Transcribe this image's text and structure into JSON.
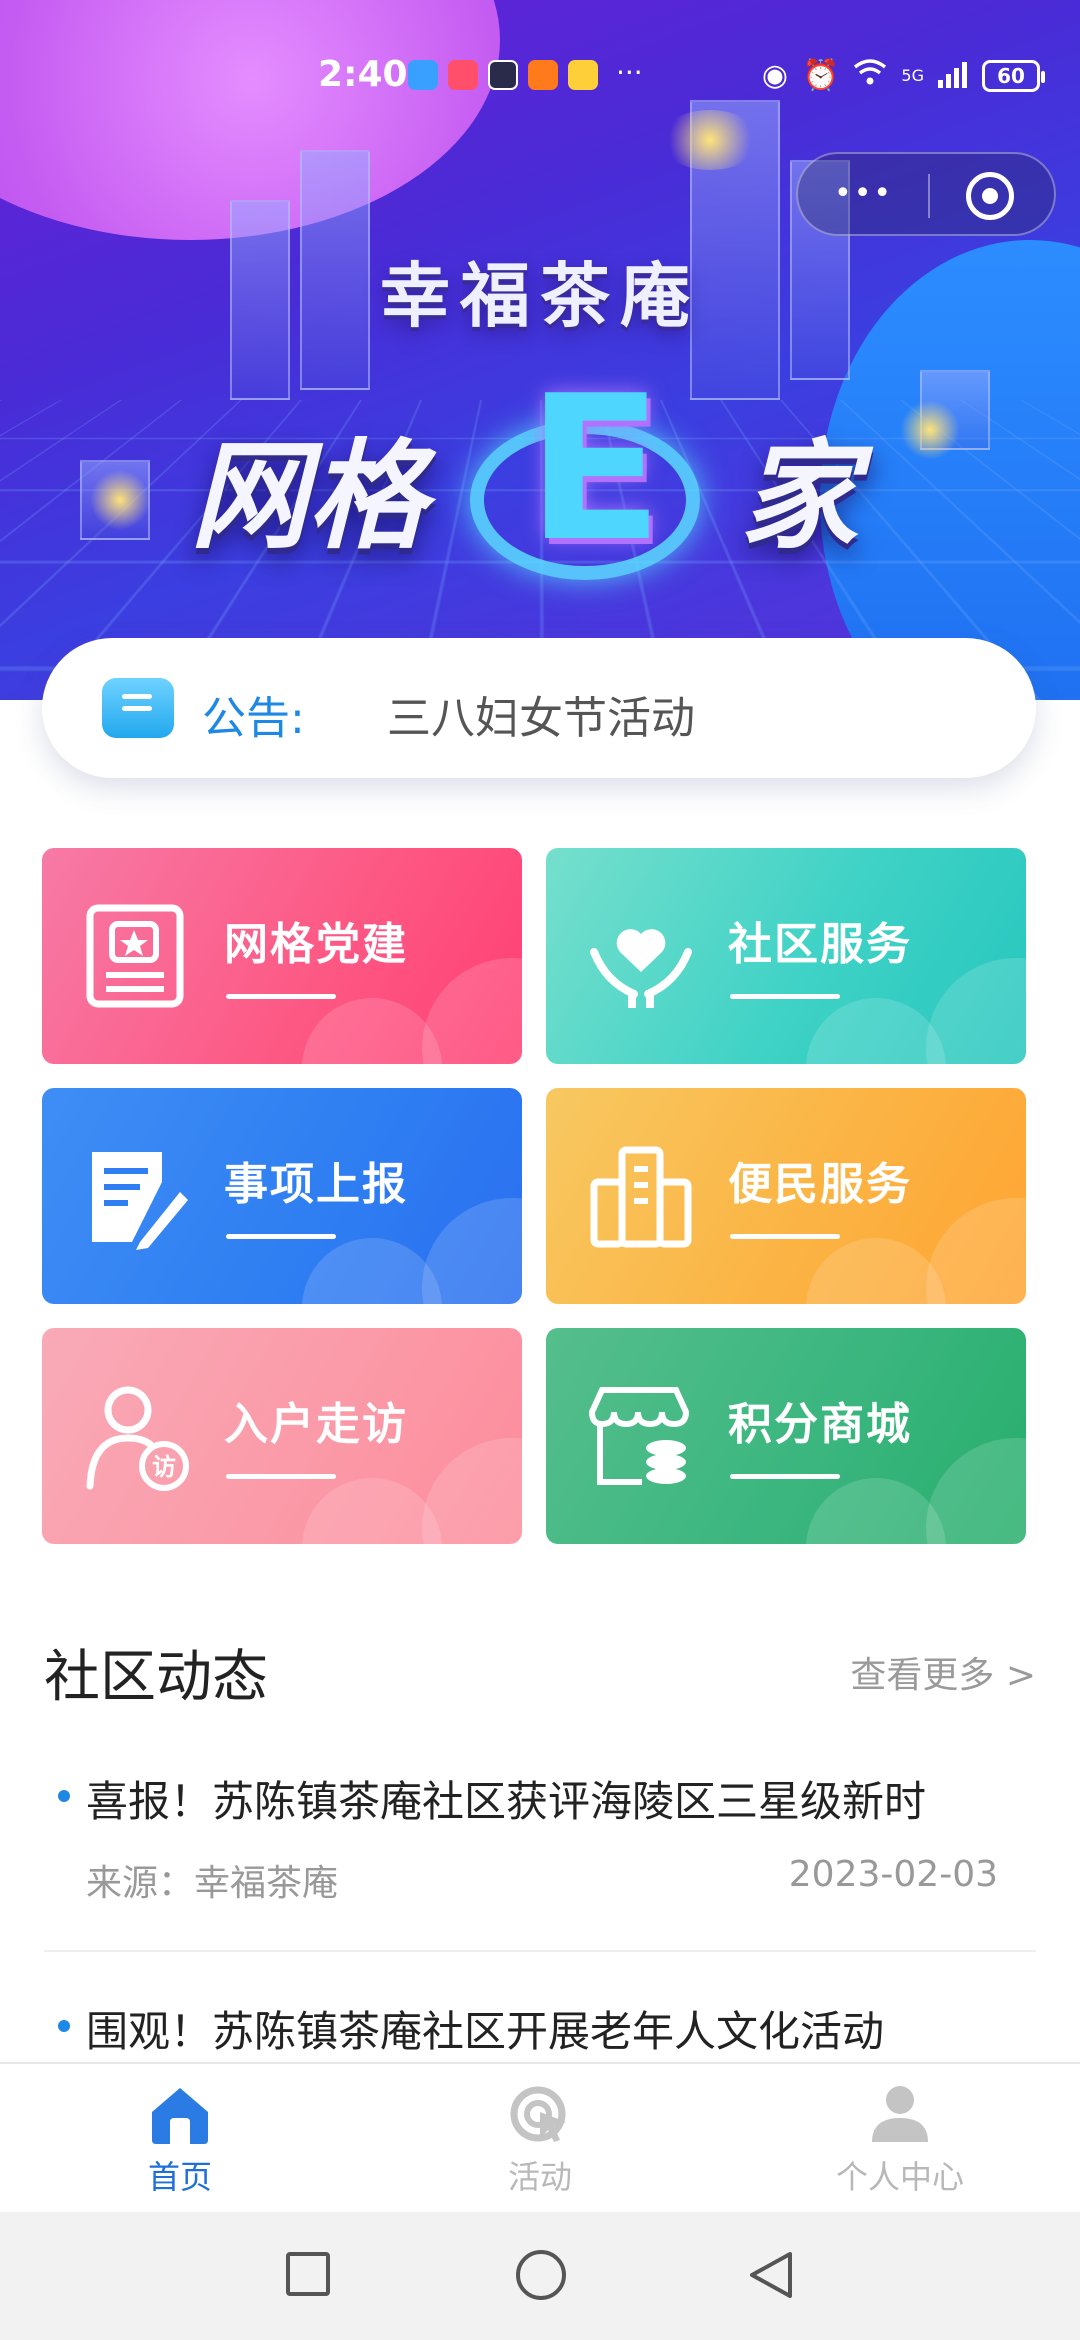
{
  "status_bar": {
    "time": "2:40",
    "network": "5G",
    "battery": "60",
    "overflow": "···"
  },
  "capsule": {
    "more": "•••"
  },
  "banner": {
    "subtitle": "幸福茶庵",
    "title_left": "网格",
    "title_mark": "E",
    "title_right": "家"
  },
  "notice": {
    "label": "公告:",
    "text": "三八妇女节活动"
  },
  "services": [
    {
      "label": "网格党建",
      "icon": "party-building-icon"
    },
    {
      "label": "社区服务",
      "icon": "heart-hands-icon"
    },
    {
      "label": "事项上报",
      "icon": "report-edit-icon"
    },
    {
      "label": "便民服务",
      "icon": "building-icon"
    },
    {
      "label": "入户走访",
      "icon": "visit-person-icon"
    },
    {
      "label": "积分商城",
      "icon": "store-coins-icon"
    }
  ],
  "news": {
    "section_title": "社区动态",
    "see_more": "查看更多 >",
    "items": [
      {
        "title": "喜报！苏陈镇茶庵社区获评海陵区三星级新时",
        "source": "来源：幸福茶庵",
        "date": "2023-02-03"
      },
      {
        "title": "围观！苏陈镇茶庵社区开展老年人文化活动"
      }
    ]
  },
  "tabbar": {
    "items": [
      {
        "label": "首页",
        "icon": "home-icon",
        "active": true
      },
      {
        "label": "活动",
        "icon": "activity-icon",
        "active": false
      },
      {
        "label": "个人中心",
        "icon": "profile-icon",
        "active": false
      }
    ]
  },
  "colors": {
    "accent": "#1e88e5",
    "tab_active": "#1e6fd8",
    "tab_inactive": "#b8b8b8"
  }
}
